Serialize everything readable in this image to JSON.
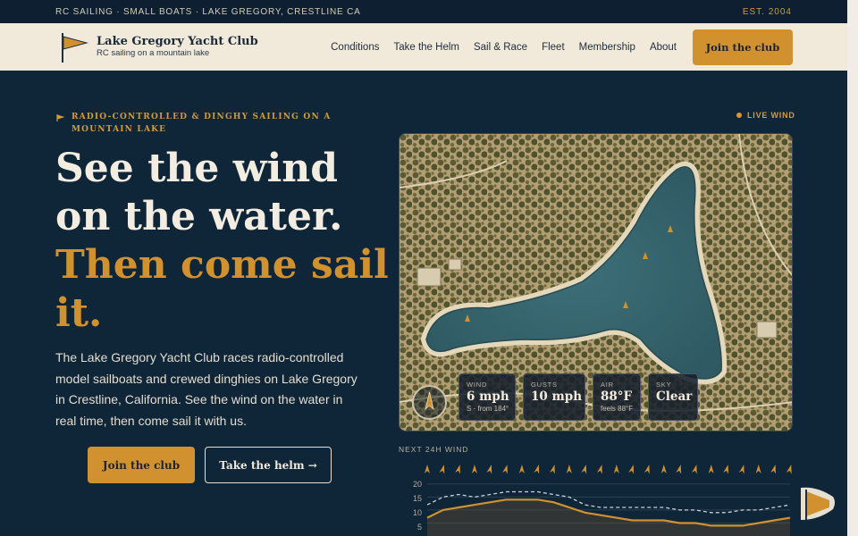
{
  "topbar": {
    "left_text": "RC SAILING · SMALL BOATS · LAKE GREGORY, CRESTLINE CA",
    "est": "EST. 2004"
  },
  "header": {
    "club_name": "Lake Gregory Yacht Club",
    "tagline": "RC sailing on a mountain lake",
    "nav": [
      "Conditions",
      "Take the Helm",
      "Sail & Race",
      "Fleet",
      "Membership",
      "About"
    ],
    "join_label": "Join the club"
  },
  "hero": {
    "eyebrow": "RADIO-CONTROLLED & DINGHY SAILING ON A MOUNTAIN LAKE",
    "headline_line1": "See the wind on the water.",
    "headline_line2": "Then come sail it.",
    "description": "The Lake Gregory Yacht Club races radio-controlled model sailboats and crewed dinghies on Lake Gregory in Crestline, California. See the wind on the water in real time, then come sail it with us.",
    "primary_button": "Join the club",
    "secondary_button": "Take the helm →"
  },
  "live_label": "LIVE WIND",
  "conditions": [
    {
      "label": "WIND",
      "value": "6 mph",
      "sub": "S · from 184°"
    },
    {
      "label": "GUSTS",
      "value": "10 mph",
      "sub": ""
    },
    {
      "label": "AIR",
      "value": "88°F",
      "sub": "feels 88°F"
    },
    {
      "label": "SKY",
      "value": "Clear",
      "sub": ""
    }
  ],
  "forecast": {
    "label": "NEXT 24H WIND",
    "y_ticks": [
      "20",
      "15",
      "10",
      "5"
    ],
    "ylim": [
      0,
      22
    ],
    "wind": [
      7,
      10,
      11,
      12,
      13,
      14,
      14,
      14,
      13,
      11,
      9,
      8,
      7,
      6,
      6,
      6,
      5,
      5,
      4,
      4,
      4,
      5,
      6,
      7
    ],
    "gusts": [
      12,
      15,
      16,
      15,
      16,
      17,
      17,
      17,
      16,
      15,
      12,
      11,
      11,
      11,
      11,
      11,
      10,
      10,
      9,
      9,
      10,
      10,
      11,
      12
    ]
  },
  "colors": {
    "navy": "#0f2538",
    "accent": "#d2912f",
    "cream": "#f1e9da",
    "lake": "#3f6f7a"
  },
  "icons": {
    "logo": "pennant-flag-icon",
    "compass": "compass-arrow-icon",
    "forecast_arrows": "wind-direction-arrow-icon",
    "floating": "pennant-flag-icon"
  }
}
